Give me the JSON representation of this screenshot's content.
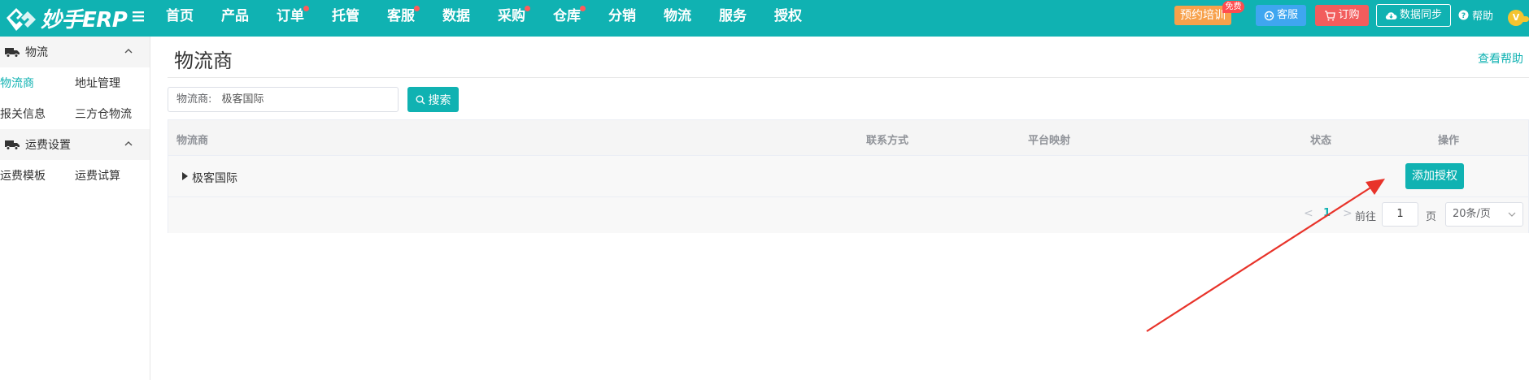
{
  "header": {
    "brand": "妙手ERP",
    "nav": [
      {
        "label": "首页",
        "dot": false
      },
      {
        "label": "产品",
        "dot": false
      },
      {
        "label": "订单",
        "dot": true
      },
      {
        "label": "托管",
        "dot": false
      },
      {
        "label": "客服",
        "dot": true
      },
      {
        "label": "数据",
        "dot": false
      },
      {
        "label": "采购",
        "dot": true
      },
      {
        "label": "仓库",
        "dot": true
      },
      {
        "label": "分销",
        "dot": false
      },
      {
        "label": "物流",
        "dot": false
      },
      {
        "label": "服务",
        "dot": false
      },
      {
        "label": "授权",
        "dot": false
      }
    ],
    "train_label": "预约培训",
    "free_badge": "免费",
    "kefu_label": "客服",
    "order_label": "订购",
    "sync_label": "数据同步",
    "help_label": "帮助",
    "vip_label": "V"
  },
  "sidebar": {
    "group1": "物流",
    "items1": [
      "物流商",
      "地址管理",
      "报关信息",
      "三方仓物流"
    ],
    "group2": "运费设置",
    "items2": [
      "运费模板",
      "运费试算"
    ]
  },
  "main": {
    "title": "物流商",
    "help": "查看帮助",
    "search": {
      "label": "物流商:",
      "value": "极客国际",
      "button": "搜索"
    },
    "table": {
      "columns": [
        "物流商",
        "联系方式",
        "平台映射",
        "状态",
        "操作"
      ],
      "rows": [
        {
          "name": "极客国际",
          "action": "添加授权"
        }
      ]
    },
    "pager": {
      "prev": "<",
      "page": "1",
      "next": ">",
      "goto": "前往",
      "input": "1",
      "unit": "页",
      "size": "20条/页"
    }
  },
  "colors": {
    "brand": "#10b2b2",
    "train": "#f7a14b",
    "kefu": "#3fa6f0",
    "order": "#f25d5d",
    "annotation_arrow": "#e8332a"
  }
}
